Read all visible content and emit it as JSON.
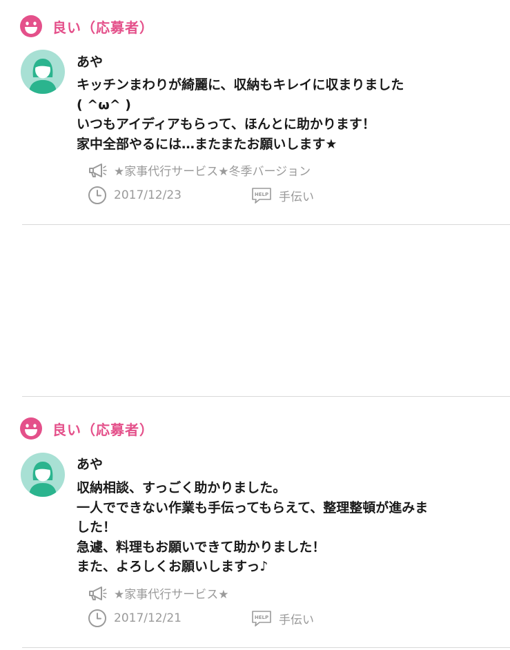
{
  "reviews": [
    {
      "rating_label": "良い（応募者）",
      "rating_icon": "smiley-face-icon",
      "username": "あや",
      "comment_lines": [
        "キッチンまわりが綺麗に、収納もキレイに収まりました",
        "( ^ω^ )",
        "いつもアイディアもらって、ほんとに助かります！",
        "家中全部やるには…またまたお願いします★"
      ],
      "service": "★家事代行サービス★冬季バージョン",
      "date": "2017/12/23",
      "category": "手伝い",
      "category_icon_text": "HELP"
    },
    {
      "rating_label": "良い（応募者）",
      "rating_icon": "smiley-face-icon",
      "username": "あや",
      "comment_lines": [
        "収納相談、すっごく助かりました。",
        "一人でできない作業も手伝ってもらえて、整理整頓が進みま",
        "した！",
        "急遽、料理もお願いできて助かりました！",
        "また、よろしくお願いしますっ♪"
      ],
      "service": "★家事代行サービス★",
      "date": "2017/12/21",
      "category": "手伝い",
      "category_icon_text": "HELP"
    }
  ],
  "colors": {
    "accent_pink": "#e4508a",
    "avatar_bg": "#a8e0d4",
    "avatar_body": "#2bb48e",
    "meta_gray": "#9a9a9a",
    "divider": "#d8d8d8"
  }
}
